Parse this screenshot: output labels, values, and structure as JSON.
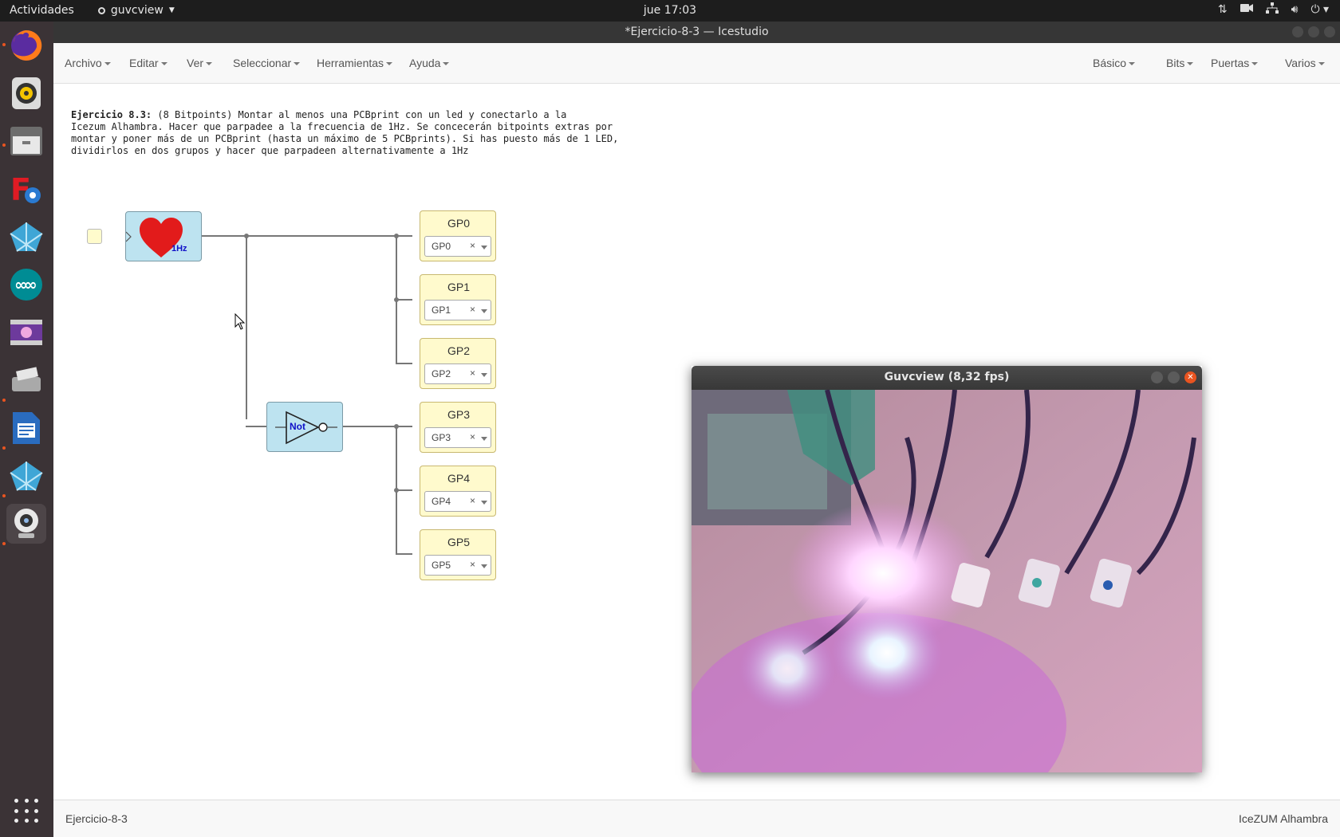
{
  "topbar": {
    "activities": "Actividades",
    "app_name": "guvcview",
    "clock": "jue 17:03",
    "tray_icons": [
      "transfer-icon",
      "camera-icon",
      "network-icon",
      "volume-icon",
      "power-icon"
    ]
  },
  "dock": {
    "items": [
      "firefox-icon",
      "rhythmbox-icon",
      "files-icon",
      "freecad-icon",
      "icestudio-icon",
      "arduino-icon",
      "video-editor-icon",
      "scanner-icon",
      "writer-icon",
      "icestudio-icon",
      "cheese-webcam-icon"
    ],
    "show_apps": "apps-grid-icon"
  },
  "window": {
    "title": "*Ejercicio-8-3 — Icestudio"
  },
  "menubar": {
    "left": [
      "Archivo",
      "Editar",
      "Ver",
      "Seleccionar",
      "Herramientas",
      "Ayuda"
    ],
    "right": [
      "Básico",
      "Bits",
      "Puertas",
      "Varios"
    ]
  },
  "info": {
    "title": "Ejercicio 8.3:",
    "body": " (8 Bitpoints) Montar al menos una PCBprint con un led y conectarlo a la\nIcezum Alhambra. Hacer que parpadee a la frecuencia de 1Hz. Se concecerán bitpoints extras por\nmontar y poner más de un PCBprint (hasta un máximo de 5 PCBprints). Si has puesto más de 1 LED,\ndividirlos en dos grupos y hacer que parpadeen alternativamente a 1Hz"
  },
  "blocks": {
    "heart_label": "1Hz",
    "not_label": "Not",
    "outputs": [
      {
        "label": "GP0",
        "value": "GP0"
      },
      {
        "label": "GP1",
        "value": "GP1"
      },
      {
        "label": "GP2",
        "value": "GP2"
      },
      {
        "label": "GP3",
        "value": "GP3"
      },
      {
        "label": "GP4",
        "value": "GP4"
      },
      {
        "label": "GP5",
        "value": "GP5"
      }
    ]
  },
  "guvcview": {
    "title": "Guvcview  (8,32 fps)"
  },
  "statusbar": {
    "project": "Ejercicio-8-3",
    "board": "IceZUM Alhambra"
  },
  "colors": {
    "dock_bg": "#3b3336",
    "topbar_bg": "#1d1d1d",
    "block_blue": "#bde3f0",
    "block_yellow": "#fffacd",
    "close_orange": "#e95420"
  }
}
